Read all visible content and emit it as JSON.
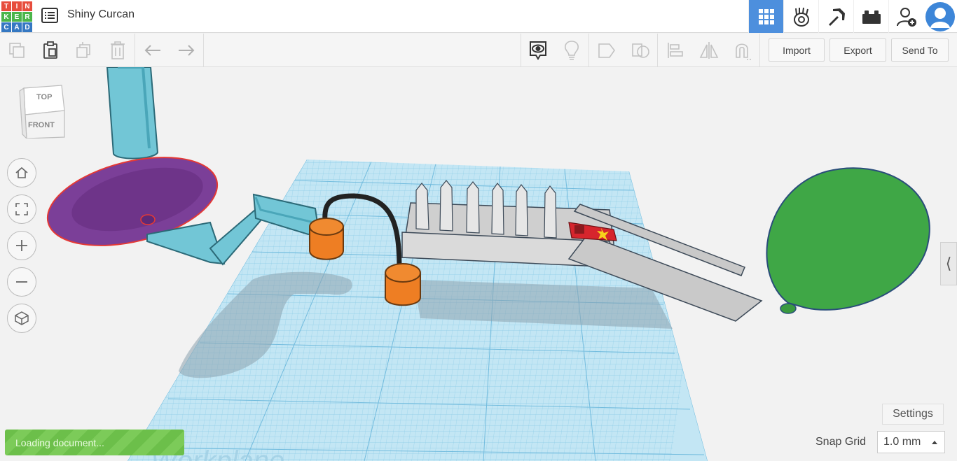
{
  "app": {
    "logo_letters": [
      "T",
      "I",
      "N",
      "K",
      "E",
      "R",
      "C",
      "A",
      "D"
    ],
    "logo_colors": [
      "#e74d3d",
      "#e74d3d",
      "#e74d3d",
      "#4bb54a",
      "#4bb54a",
      "#4bb54a",
      "#3578c2",
      "#3578c2",
      "#3578c2"
    ],
    "title": "Shiny Curcan"
  },
  "topnav": {
    "items": [
      {
        "icon": "3d-design-grid-icon",
        "active": true
      },
      {
        "icon": "codeblocks-icon",
        "active": false
      },
      {
        "icon": "minecraft-pickaxe-icon",
        "active": false
      },
      {
        "icon": "lego-brick-icon",
        "active": false
      },
      {
        "icon": "add-user-icon",
        "active": false
      },
      {
        "icon": "avatar-icon",
        "active": false
      }
    ],
    "accent": "#4d8fdd"
  },
  "toolbar": {
    "import_label": "Import",
    "export_label": "Export",
    "send_to_label": "Send To"
  },
  "viewcube": {
    "top": "TOP",
    "front": "FRONT"
  },
  "status": {
    "loading": "Loading document...",
    "settings_label": "Settings",
    "snap_grid_label": "Snap Grid",
    "snap_grid_value": "1.0 mm"
  },
  "workplane": {
    "watermark": "Workplane"
  },
  "colors": {
    "workplane": "#bfe4f3",
    "grid_line": "#7cc3e2",
    "funnel": "#7b3f98",
    "selection_outline": "#e53935",
    "pipe": "#6fc6d6",
    "cylinder": "#ee7e23",
    "rail": "#c8c8c8",
    "balloon": "#3ea346",
    "car": "#d6252d"
  }
}
